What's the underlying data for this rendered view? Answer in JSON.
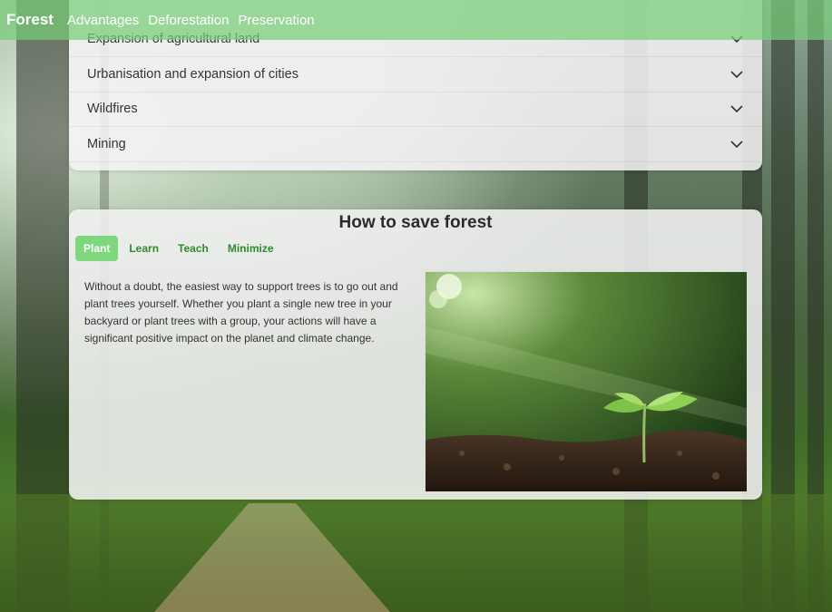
{
  "navbar": {
    "brand": "Forest",
    "links": [
      "Advantages",
      "Deforestation",
      "Preservation"
    ]
  },
  "accordion": {
    "items": [
      "Expansion of agricultural land",
      "Urbanisation and expansion of cities",
      "Wildfires",
      "Mining"
    ]
  },
  "save": {
    "title": "How to save forest",
    "tabs": [
      "Plant",
      "Learn",
      "Teach",
      "Minimize"
    ],
    "active_tab": "Plant",
    "text": "Without a doubt, the easiest way to support trees is to go out and plant trees yourself. Whether you plant a single new tree in your backyard or plant trees with a group, your actions will have a significant positive impact on the planet and climate change."
  },
  "colors": {
    "navbar": "#78cd78",
    "tab_active": "#7ed67e",
    "tab_text": "#2e8b2e"
  },
  "icons": [
    "chevron-down-icon"
  ]
}
